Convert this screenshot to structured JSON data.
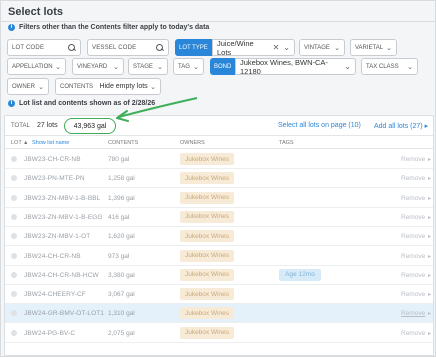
{
  "title": "Select lots",
  "filter_notice": "Filters other than the Contents filter apply to today's data",
  "filters": {
    "lot_code_placeholder": "LOT CODE",
    "vessel_code_placeholder": "VESSEL CODE",
    "lot_type_label": "LOT TYPE",
    "lot_type_value": "Juice/Wine Lots",
    "vintage": "VINTAGE",
    "varietal": "VARIETAL",
    "appellation": "APPELLATION",
    "vineyard": "VINEYARD",
    "stage": "STAGE",
    "tag": "TAG",
    "bond_label": "BOND",
    "bond_value": "Jukebox Wines, BWN-CA-12180",
    "tax_class": "TAX CLASS",
    "owner": "OWNER",
    "contents": "CONTENTS",
    "contents_value": "Hide empty lots"
  },
  "list_notice": "Lot list and contents shown as of 2/28/26",
  "summary": {
    "total_label": "TOTAL",
    "lot_count": "27 lots",
    "total_gal": "43,963 gal",
    "select_page": "Select all lots on page (10)",
    "add_all": "Add all lots (27)"
  },
  "columns": {
    "lot": "LOT",
    "sort": "Show list name",
    "contents": "CONTENTS",
    "owners": "OWNERS",
    "tags": "TAGS"
  },
  "rows": [
    {
      "lot": "JBW23-CH-CR-NB",
      "contents": "780 gal",
      "owner": "Jukebox Wines",
      "tag": "",
      "action": "Remove"
    },
    {
      "lot": "JBW23-PN-MTE-PN",
      "contents": "1,258 gal",
      "owner": "Jukebox Wines",
      "tag": "",
      "action": "Remove"
    },
    {
      "lot": "JBW23-ZN-MBV-1-B-BBL",
      "contents": "1,396 gal",
      "owner": "Jukebox Wines",
      "tag": "",
      "action": "Remove"
    },
    {
      "lot": "JBW23-ZN-MBV-1-B-EGG",
      "contents": "416 gal",
      "owner": "Jukebox Wines",
      "tag": "",
      "action": "Remove"
    },
    {
      "lot": "JBW23-ZN-MBV-1-OT",
      "contents": "1,620 gal",
      "owner": "Jukebox Wines",
      "tag": "",
      "action": "Remove"
    },
    {
      "lot": "JBW24-CH-CR-NB",
      "contents": "973 gal",
      "owner": "Jukebox Wines",
      "tag": "",
      "action": "Remove"
    },
    {
      "lot": "JBW24-CH-CR-NB-HCW",
      "contents": "3,380 gal",
      "owner": "Jukebox Wines",
      "tag": "Age 12mo",
      "action": "Remove"
    },
    {
      "lot": "JBW24-CHEERY-CF",
      "contents": "3,067 gal",
      "owner": "Jukebox Wines",
      "tag": "",
      "action": "Remove"
    },
    {
      "lot": "JBW24-GR-BMV-OT-LOT1",
      "contents": "1,310 gal",
      "owner": "Jukebox Wines",
      "tag": "",
      "action": "Remove"
    },
    {
      "lot": "JBW24-PG-BV-C",
      "contents": "2,075 gal",
      "owner": "Jukebox Wines",
      "tag": "",
      "action": "Remove"
    }
  ],
  "colors": {
    "accent": "#2a86d8",
    "highlight": "#3fae5a",
    "owner_badge": "#f7ebd8"
  }
}
